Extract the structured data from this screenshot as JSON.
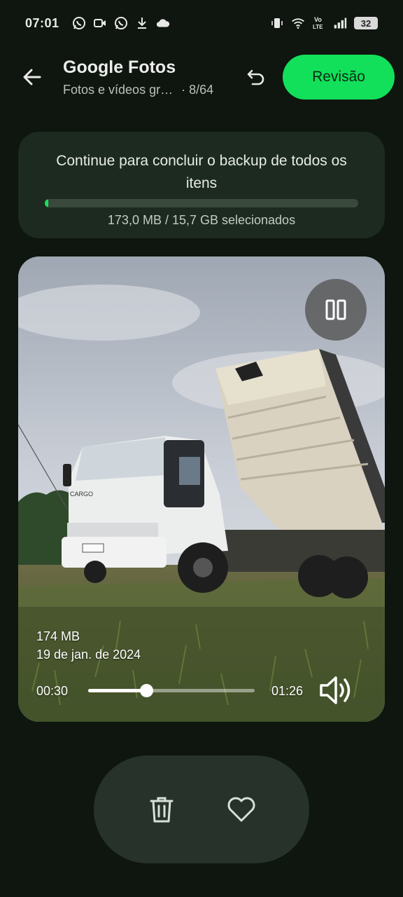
{
  "status_bar": {
    "time": "07:01",
    "battery_level": "32",
    "left_icons": [
      "whatsapp-icon",
      "video-call-icon",
      "whatsapp-icon",
      "download-icon",
      "cloud-icon"
    ],
    "right_icons": [
      "vibrate-icon",
      "wifi-icon",
      "volte-icon",
      "signal-icon",
      "battery-icon"
    ],
    "volte_label": "Vo\nLTE"
  },
  "app_bar": {
    "title": "Google Fotos",
    "subtitle": "Fotos e vídeos gr…",
    "count": "· 8/64",
    "review_label": "Revisão"
  },
  "backup": {
    "message": "Continue para concluir o backup de todos os itens",
    "progress": 0.011,
    "size_text": "173,0 MB / 15,7 GB selecionados"
  },
  "media": {
    "size": "174 MB",
    "date": "19 de jan. de 2024",
    "current_time": "00:30",
    "total_time": "01:26",
    "playback_fraction": 0.35,
    "truck_brand": "CARGO"
  },
  "colors": {
    "background": "#0e160f",
    "accent": "#13e05a",
    "card": "#1d2a20",
    "pill": "#27332a"
  }
}
